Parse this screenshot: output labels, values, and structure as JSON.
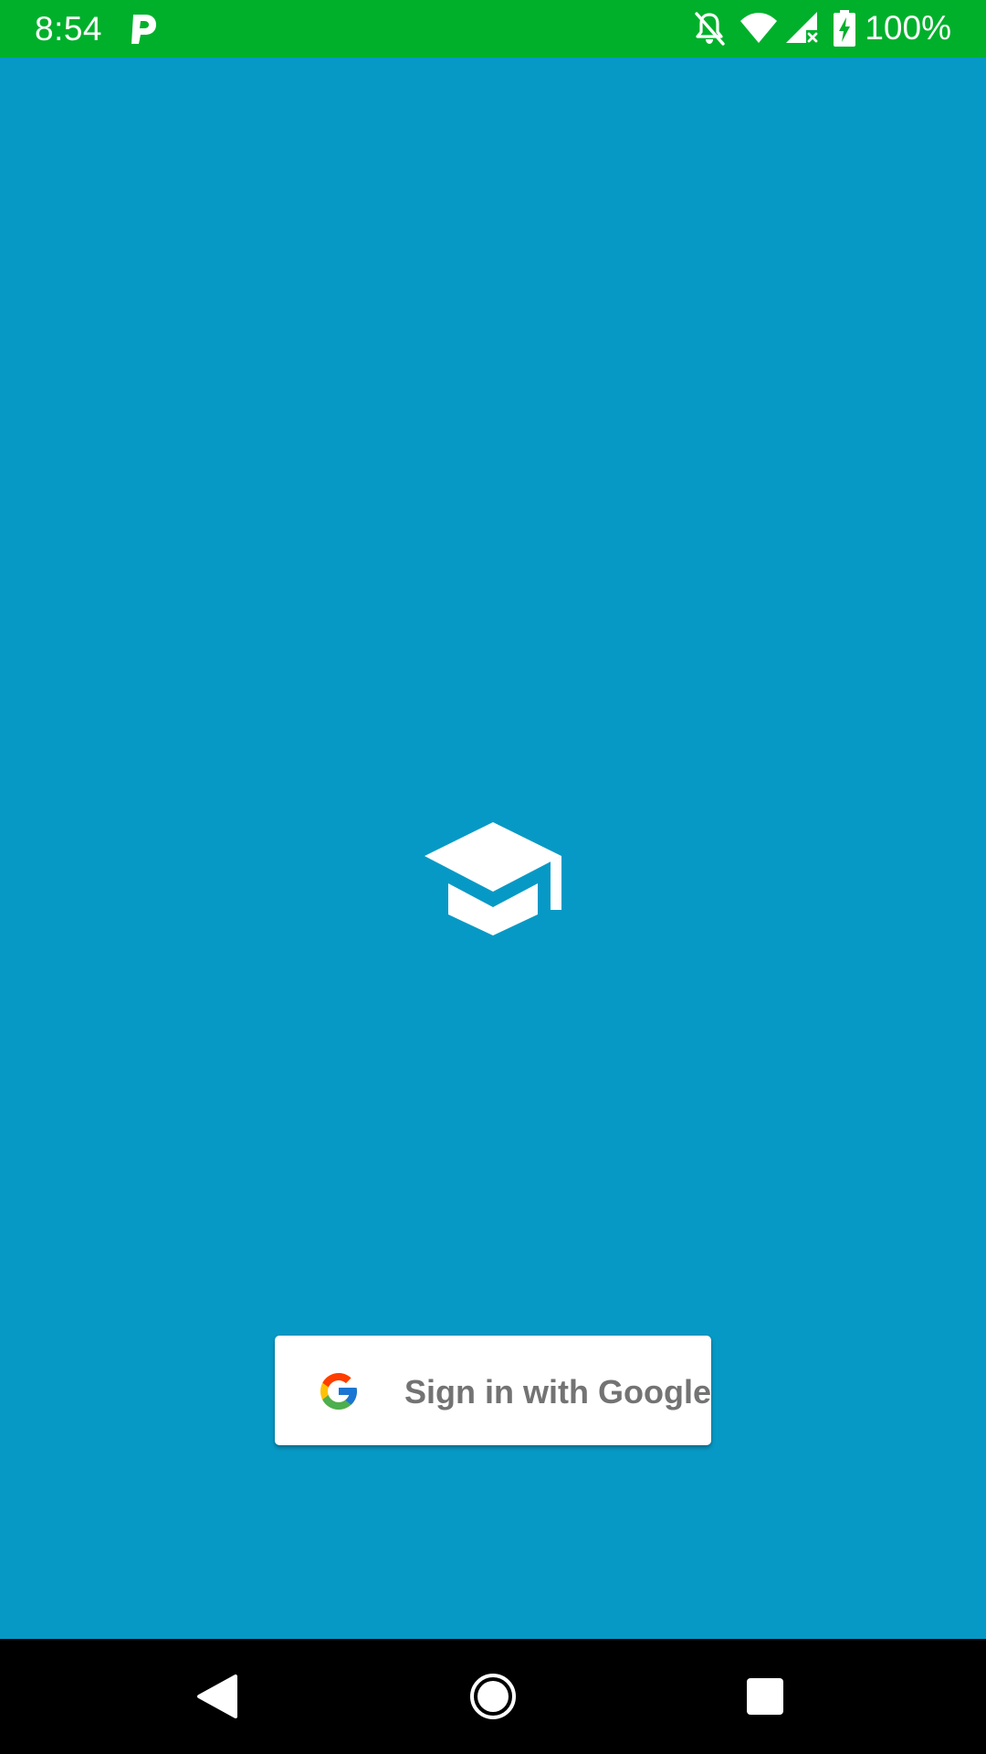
{
  "status_bar": {
    "time": "8:54",
    "battery_text": "100%",
    "background_color": "#00b02b",
    "icons": [
      "parking-app-icon",
      "notifications-off-icon",
      "wifi-icon",
      "cell-signal-no-data-icon",
      "battery-charging-icon"
    ]
  },
  "main": {
    "background_color": "#0799c5",
    "logo_icon": "graduation-cap-icon"
  },
  "signin": {
    "label": "Sign in with Google",
    "icon": "google-g-icon"
  },
  "nav_bar": {
    "icons": [
      "back-icon",
      "home-icon",
      "recents-icon"
    ]
  }
}
